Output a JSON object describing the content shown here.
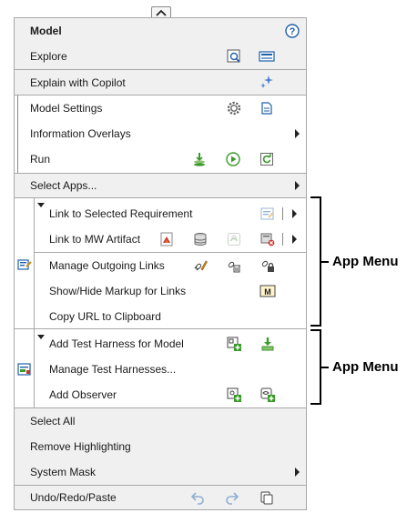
{
  "model_section": {
    "title": "Model",
    "help_icon": "help-icon",
    "items": [
      {
        "label": "Explore"
      },
      {
        "label": "Explain with Copilot"
      }
    ]
  },
  "settings_section": {
    "items": [
      {
        "label": "Model Settings"
      },
      {
        "label": "Information Overlays"
      },
      {
        "label": "Run"
      }
    ]
  },
  "apps_section": {
    "select_apps": "Select Apps..."
  },
  "requirements_app": {
    "items": [
      {
        "label": "Link to Selected Requirement"
      },
      {
        "label": "Link to MW Artifact"
      },
      {
        "label": "Manage Outgoing Links"
      },
      {
        "label": "Show/Hide Markup for Links"
      },
      {
        "label": "Copy URL to Clipboard"
      }
    ]
  },
  "test_app": {
    "items": [
      {
        "label": "Add Test Harness for Model"
      },
      {
        "label": "Manage Test Harnesses..."
      },
      {
        "label": "Add Observer"
      }
    ]
  },
  "bottom_section": {
    "items": [
      {
        "label": "Select All"
      },
      {
        "label": "Remove Highlighting"
      },
      {
        "label": "System Mask"
      },
      {
        "label": "Undo/Redo/Paste"
      }
    ]
  },
  "annotations": {
    "app_menu_1": "App Menu",
    "app_menu_2": "App Menu"
  },
  "colors": {
    "border": "#a8a8a8",
    "section_gray": "#f0f0f0",
    "icon_blue": "#1f5fa8",
    "icon_green": "#3a9a2a",
    "icon_red": "#c8362b"
  }
}
